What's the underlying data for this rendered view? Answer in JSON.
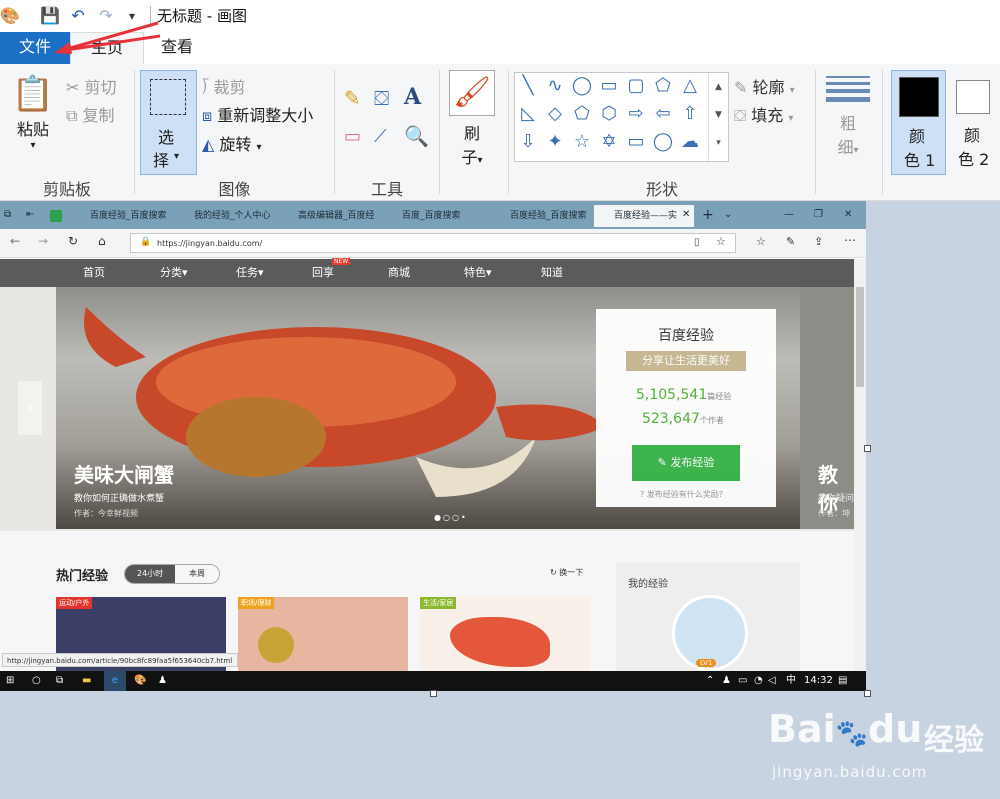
{
  "title": "无标题 - 画图",
  "ribbon_tabs": [
    "文件",
    "主页",
    "查看"
  ],
  "clipboard": {
    "paste": "粘贴",
    "cut": "剪切",
    "copy": "复制",
    "label": "剪贴板"
  },
  "image": {
    "select_line1": "选",
    "select_line2": "择",
    "crop": "裁剪",
    "resize": "重新调整大小",
    "rotate": "旋转",
    "label": "图像"
  },
  "tools": {
    "label": "工具"
  },
  "brush": {
    "line1": "刷",
    "line2": "子"
  },
  "shapes": {
    "outline": "轮廓",
    "fill": "填充",
    "label": "形状"
  },
  "size": {
    "line1": "粗",
    "line2": "细"
  },
  "colors": {
    "color1_line1": "颜",
    "color1_line2": "色 1",
    "color2_line1": "颜",
    "color2_line2": "色 2",
    "color1_value": "#000000",
    "color2_value": "#ffffff"
  },
  "browser": {
    "tabs": [
      "百度经验_百度搜索",
      "我的经验_个人中心",
      "高级编辑器_百度经",
      "百度_百度搜索",
      "百度经验_百度搜索",
      "百度经验——实"
    ],
    "url": "https://jingyan.baidu.com/",
    "nav": [
      "首页",
      "分类",
      "任务",
      "回享",
      "商城",
      "特色",
      "知道"
    ],
    "nav_badge": "NEW",
    "hero": {
      "title": "美味大闸蟹",
      "sub": "教你如何正确做水煮蟹",
      "author": "作者：今幸鲜视频",
      "right_title": "教你",
      "right_sub": "教你疑问",
      "right_author": "作者：坤"
    },
    "card": {
      "title": "百度经验",
      "slogan": "分享让生活更美好",
      "count1": "5,105,541",
      "count1_unit": "篇经验",
      "count2": "523,647",
      "count2_unit": "个作者",
      "publish": "发布经验",
      "help": "发布经验有什么奖励?"
    },
    "hot": {
      "title": "热门经验",
      "seg1": "24小时",
      "seg2": "本周",
      "refresh": "换一下",
      "tags": [
        "运动/户外",
        "职场/理财",
        "生活/家居"
      ],
      "mine": "我的经验",
      "level": "LV1"
    },
    "status_url": "http://jingyan.baidu.com/article/90bc8fc89faa5f653640cb7.html",
    "taskbar": {
      "ime": "中",
      "time": "14:32"
    }
  },
  "watermark": {
    "logo": "Bai",
    "logo2": "du",
    "cn": "经验",
    "url": "jingyan.baidu.com"
  },
  "accent": "#1b6fc4",
  "annotation_arrow_color": "#e8303a"
}
